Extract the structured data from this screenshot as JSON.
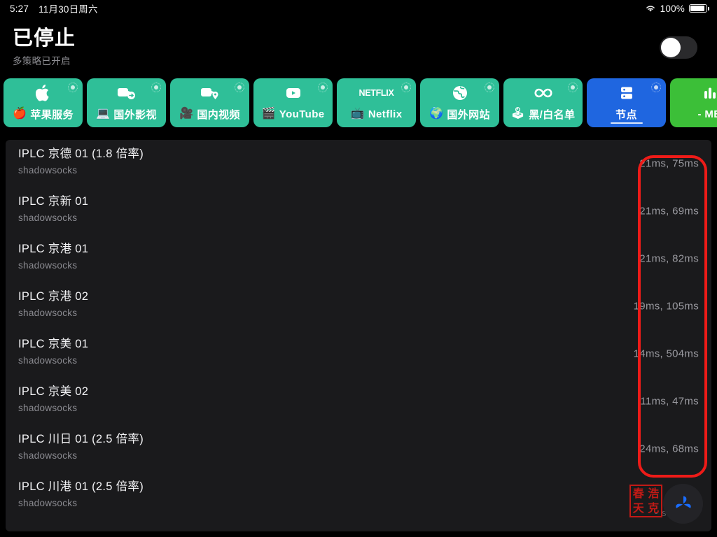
{
  "statusbar": {
    "time": "5:27",
    "date": "11月30日周六",
    "battery_percent": "100%",
    "wifi_icon": "wifi-icon",
    "battery_icon": "battery-full-icon"
  },
  "header": {
    "title": "已停止",
    "subtitle": "多策略已开启",
    "toggle_state": "off"
  },
  "cards": [
    {
      "label": "苹果服务",
      "emoji": "🍎",
      "icon": "apple-logo-icon",
      "color": "#2fbf98",
      "selected": false
    },
    {
      "label": "国外影视",
      "emoji": "💻",
      "icon": "video-forward-icon",
      "color": "#2fbf98",
      "selected": false
    },
    {
      "label": "国内视频",
      "emoji": "🎥",
      "icon": "video-location-icon",
      "color": "#2fbf98",
      "selected": false
    },
    {
      "label": "YouTube",
      "emoji": "🎬",
      "icon": "youtube-play-icon",
      "color": "#2fbf98",
      "selected": false
    },
    {
      "label": "Netflix",
      "emoji": "📺",
      "icon": "netflix-wordmark-icon",
      "color": "#2fbf98",
      "selected": false
    },
    {
      "label": "国外网站",
      "emoji": "🌍",
      "icon": "globe-icon",
      "color": "#2fbf98",
      "selected": false
    },
    {
      "label": "黑/白名单",
      "emoji": "🕹",
      "icon": "infinity-icon",
      "color": "#2fbf98",
      "selected": false
    },
    {
      "label": "节点",
      "emoji": "",
      "icon": "server-stack-icon",
      "color": "#1f66e0",
      "selected": true
    },
    {
      "label": "- MB",
      "emoji": "",
      "icon": "bar-chart-icon",
      "color": "#3cbf38",
      "selected": false
    }
  ],
  "node_list": [
    {
      "name": "IPLC 京德 01 (1.8 倍率)",
      "protocol": "shadowsocks",
      "latency": "21ms, 75ms"
    },
    {
      "name": "IPLC 京新 01",
      "protocol": "shadowsocks",
      "latency": "21ms, 69ms"
    },
    {
      "name": "IPLC 京港 01",
      "protocol": "shadowsocks",
      "latency": "21ms, 82ms"
    },
    {
      "name": "IPLC 京港 02",
      "protocol": "shadowsocks",
      "latency": "19ms, 105ms"
    },
    {
      "name": "IPLC 京美 01",
      "protocol": "shadowsocks",
      "latency": "14ms, 504ms"
    },
    {
      "name": "IPLC 京美 02",
      "protocol": "shadowsocks",
      "latency": "11ms, 47ms"
    },
    {
      "name": "IPLC 川日 01 (2.5 倍率)",
      "protocol": "shadowsocks",
      "latency": "24ms, 68ms"
    },
    {
      "name": "IPLC 川港 01 (2.5 倍率)",
      "protocol": "shadowsocks",
      "latency": ""
    }
  ],
  "annotation": {
    "shape": "rounded-rectangle",
    "color": "#ee1b18",
    "target": "latency-column"
  },
  "watermark": {
    "seal_chars": [
      "春",
      "浩",
      "天",
      "克"
    ],
    "seal_color": "#c21a16",
    "logo_icon": "propeller-logo-icon",
    "logo_color": "#1a6dff",
    "faint_text": "-        s"
  }
}
